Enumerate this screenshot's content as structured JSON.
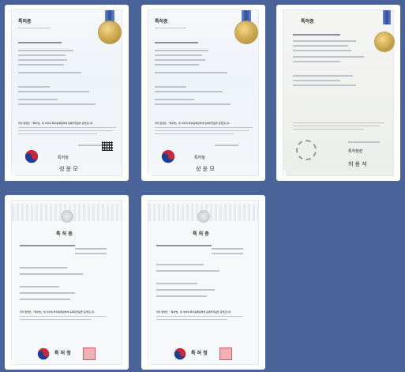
{
  "certificates": [
    {
      "number": "1",
      "title": "특허증",
      "body_text": "위의 발명은 「특허법」에 의하여 특허등록원부에 등록되었음을 증명합니다.",
      "office": "특허청",
      "signature": "성 윤 모"
    },
    {
      "number": "2",
      "title": "특허증",
      "body_text": "위의 발명은 「특허법」에 의하여 특허등록원부에 등록되었음을 증명합니다.",
      "office": "특허청",
      "signature": "성 윤 모"
    },
    {
      "number": "3",
      "title": "특허증",
      "office": "특허청장",
      "signature": "허 용 석"
    },
    {
      "number": "4",
      "title": "특 허 증",
      "body_text": "위의 발명은 「특허법」에 의하여 특허등록원부에 등록되었음을 증명합니다.",
      "office": "특 허 청"
    },
    {
      "number": "5",
      "title": "특 허 증",
      "body_text": "위의 발명은 「특허법」에 의하여 특허등록원부에 등록되었음을 증명합니다.",
      "office": "특 허 청"
    }
  ],
  "colors": {
    "background": "#4a6499",
    "medal": "#c9a54b",
    "ribbon": "#2d4aa3",
    "stamp": "#d4576a"
  },
  "icons": [
    "gold-medal-icon",
    "ribbon-icon",
    "taegeuk-emblem-icon",
    "qr-code-icon",
    "red-stamp-icon",
    "official-seal-icon"
  ]
}
